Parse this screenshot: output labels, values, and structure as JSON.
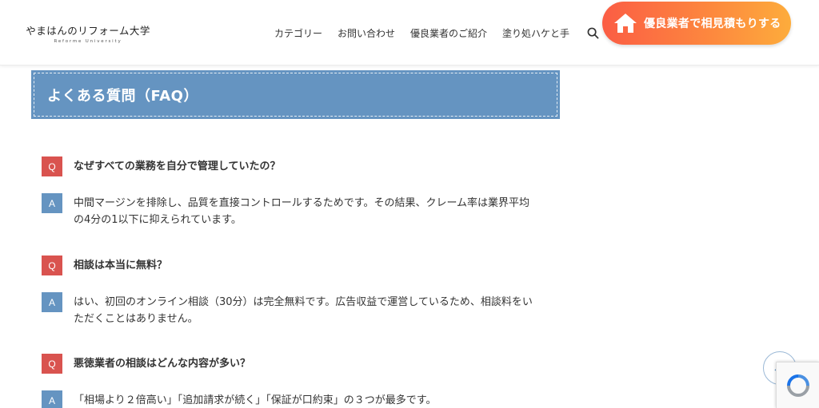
{
  "header": {
    "logo_main": "やまはんのリフォーム大学",
    "logo_sub": "Reforme University",
    "nav": [
      {
        "label": "カテゴリー"
      },
      {
        "label": "お問い合わせ"
      },
      {
        "label": "優良業者のご紹介"
      },
      {
        "label": "塗り処ハケと手"
      }
    ],
    "cta_label": "優良業者で相見積もりする"
  },
  "faq": {
    "title": "よくある質問（FAQ）",
    "q_badge": "Q",
    "a_badge": "A",
    "items": [
      {
        "q": "なぜすべての業務を自分で管理していたの？",
        "a": "中間マージンを排除し、品質を直接コントロールするためです。その結果、クレーム率は業界平均の4分の1以下に抑えられています。"
      },
      {
        "q": "相談は本当に無料？",
        "a": "はい、初回のオンライン相談（30分）は完全無料です。広告収益で運営しているため、相談料をいただくことはありません。"
      },
      {
        "q": "悪徳業者の相談はどんな内容が多い？",
        "a": "「相場より２倍高い」「追加請求が続く」「保証が口約束」の３つが最多です。"
      }
    ]
  },
  "colors": {
    "accent_blue": "#6594c1",
    "q_red": "#d9534f",
    "cta_start": "#fb5d44",
    "cta_end": "#fdac3c"
  },
  "icons": {
    "search": "search-icon",
    "cta": "home-icon",
    "to_top": "chevron-up-icon",
    "recaptcha": "recaptcha-icon"
  }
}
